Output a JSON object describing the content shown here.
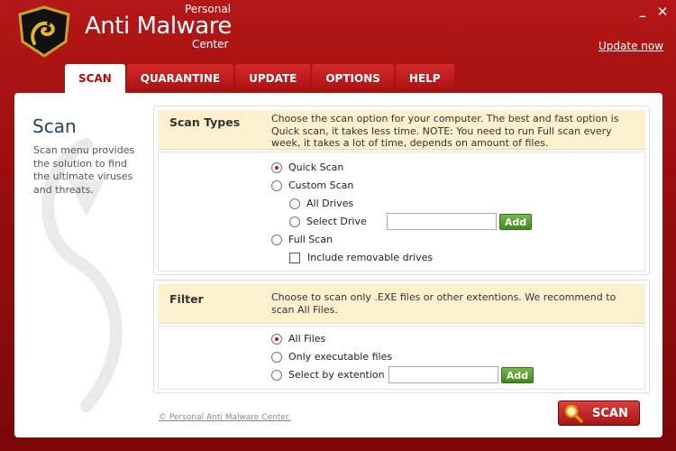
{
  "header": {
    "brand_top": "Personal",
    "brand_main": "Anti Malware",
    "brand_bottom": "Center",
    "minimize_icon": "_",
    "close_icon": "✕",
    "update_now": "Update now"
  },
  "tabs": [
    {
      "label": "SCAN",
      "active": true
    },
    {
      "label": "QUARANTINE",
      "active": false
    },
    {
      "label": "UPDATE",
      "active": false
    },
    {
      "label": "OPTIONS",
      "active": false
    },
    {
      "label": "HELP",
      "active": false
    }
  ],
  "sidebar": {
    "title": "Scan",
    "description": "Scan menu provides the solution to find the ultimate viruses and threats."
  },
  "scan_types": {
    "title": "Scan Types",
    "description": "Choose the scan option for your computer. The best and fast option is Quick scan, it takes less time. NOTE: You need to run Full scan every week, it takes a lot of time, depends on amount of files.",
    "options": {
      "quick": "Quick Scan",
      "custom": "Custom Scan",
      "all_drives": "All Drives",
      "select_drive": "Select Drive",
      "full": "Full Scan",
      "include_removable": "Include removable drives"
    },
    "selected": "Quick Scan",
    "drive_value": "",
    "add_label": "Add"
  },
  "filter": {
    "title": "Filter",
    "description": "Choose to scan only .EXE files or other extentions. We recommend to scan All Files.",
    "options": {
      "all": "All Files",
      "exe": "Only executable files",
      "ext": "Select by extention"
    },
    "selected": "All Files",
    "ext_value": "",
    "add_label": "Add"
  },
  "footer": {
    "copyright": "© Personal Anti Malware Center.",
    "scan_button": "SCAN"
  },
  "colors": {
    "brand_red": "#b51717",
    "accent_green": "#3f8a1c",
    "header_yellow": "#fbf1cf"
  }
}
